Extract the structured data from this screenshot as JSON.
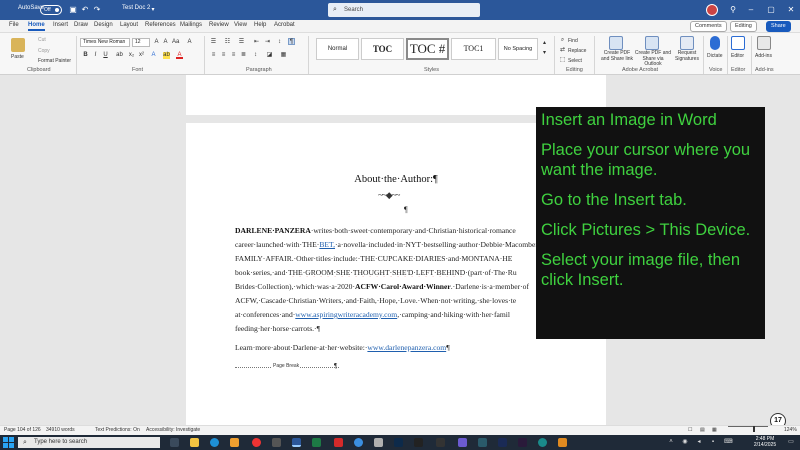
{
  "titlebar": {
    "autosave_label": "AutoSave",
    "autosave_state": "Off",
    "doc_name": "Test Doc 2",
    "search_placeholder": "Search"
  },
  "menu": {
    "tabs": [
      "File",
      "Home",
      "Insert",
      "Draw",
      "Design",
      "Layout",
      "References",
      "Mailings",
      "Review",
      "View",
      "Help",
      "Acrobat"
    ],
    "active": "Home",
    "comments_label": "Comments",
    "editing_label": "Editing",
    "share_label": "Share"
  },
  "ribbon": {
    "clipboard": {
      "paste": "Paste",
      "cut": "Cut",
      "copy": "Copy",
      "format_painter": "Format Painter",
      "group": "Clipboard"
    },
    "font": {
      "name": "Times New Roman",
      "size": "12",
      "group": "Font"
    },
    "paragraph": {
      "group": "Paragraph"
    },
    "styles": {
      "items": [
        "Normal",
        "TOC",
        "TOC #",
        "TOC1",
        "No Spacing"
      ],
      "group": "Styles"
    },
    "editing": {
      "find": "Find",
      "replace": "Replace",
      "select": "Select",
      "group": "Editing"
    },
    "acrobat": {
      "create_share": "Create PDF and Share link",
      "create_outlook": "Create PDF and Share via Outlook",
      "group": "Adobe Acrobat"
    },
    "request_signatures": "Request Signatures",
    "voice": {
      "dictate": "Dictate",
      "group": "Voice"
    },
    "editor": {
      "label": "Editor",
      "group": "Editor"
    },
    "addins": {
      "label": "Add-ins",
      "group": "Add-ins"
    }
  },
  "document": {
    "heading": "About·the·Author:¶",
    "ornament": "~~◆~~",
    "pilcrow": "¶",
    "lines": {
      "l1_bold": "DARLENE·PANZERA",
      "l1_rest": "·writes·both·sweet·contemporary·and·Christian·historical·romance",
      "l2_a": "career·launched·with·THE·",
      "l2_bet": "BET,",
      "l2_b": "·a·novella·included·in·NYT·bestselling·author·Debbie·Macomber's",
      "l3": "FAMILY·AFFAIR.·Other·titles·include:·THE·CUPCAKE·DIARIES·and·MONTANA·HE",
      "l4_a": "book·series,·and·",
      "l4_err": "THE·GROOM·SHE·THOUGHT·SHE'D·LEFT·BEHIND",
      "l4_b": "·(part·of·The·Ru",
      "l5_a": "Brides·Collection),·which·was·a·2020·",
      "l5_bold": "ACFW·Carol·Award·Winner",
      "l5_b": ".·Darlene·is·a·member·of",
      "l6": "ACFW,·Cascade·Christian·Writers,·and·Faith,·Hope,·Love.·When·not·writing,·she·loves·te",
      "l7_a": "at·conferences·and·",
      "l7_link": "www.aspiringwriteracademy.com",
      "l7_b": ",·camping·and·hiking·with·her·famil",
      "l8": "feeding·her·horse·carrots.·¶",
      "l9_a": "Learn·more·about·Darlene·at·her·website:·",
      "l9_link": "www.darlenepanzera.com",
      "l9_b": "¶"
    },
    "page_break_label": "Page Break",
    "page_break_pilcrow": "¶"
  },
  "overlay": {
    "title": "Insert an Image in Word",
    "step1": "Place your cursor where you want the image.",
    "step2": "Go to the Insert tab.",
    "step3": "Click Pictures > This Device.",
    "step4": "Select your image file, then click Insert."
  },
  "status": {
    "page": "Page 104 of 126",
    "words": "34910 words",
    "predictions": "Text Predictions: On",
    "accessibility": "Accessibility: Investigate",
    "zoom": "124%"
  },
  "badge": "17",
  "taskbar": {
    "search_placeholder": "Type here to search",
    "time": "2:48 PM",
    "date": "2/14/2025"
  },
  "colors": {
    "title_blue": "#2b579a",
    "accent_blue": "#185abd",
    "overlay_green": "#3fd13f",
    "overlay_bg": "#111111"
  }
}
